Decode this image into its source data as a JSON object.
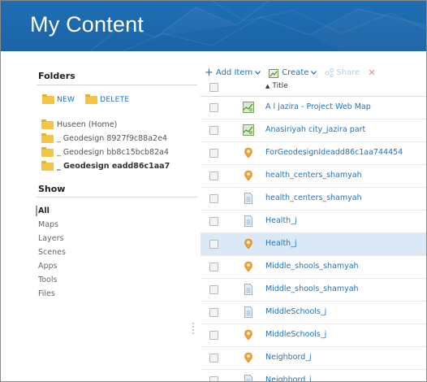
{
  "header": {
    "title": "My Content"
  },
  "sidebar": {
    "folders_heading": "Folders",
    "new_label": "NEW",
    "delete_label": "DELETE",
    "folders": [
      {
        "label": "Huseen (Home)"
      },
      {
        "label": "_ Geodesign 8927f9c88a2e4"
      },
      {
        "label": "_ Geodesign bb8c15bcb82a4"
      },
      {
        "label": "_ Geodesign eadd86c1aa7"
      }
    ],
    "show_heading": "Show",
    "show_items": [
      {
        "label": "All"
      },
      {
        "label": "Maps"
      },
      {
        "label": "Layers"
      },
      {
        "label": "Scenes"
      },
      {
        "label": "Apps"
      },
      {
        "label": "Tools"
      },
      {
        "label": "Files"
      }
    ]
  },
  "toolbar": {
    "add_item": "Add Item",
    "create": "Create",
    "share": "Share"
  },
  "table": {
    "title_header": "Title",
    "rows": [
      {
        "title": "A l jazira - Project Web Map",
        "icon": "web-map-icon"
      },
      {
        "title": "Anasiriyah city_jazira part",
        "icon": "web-map-icon"
      },
      {
        "title": "ForGeodesignIdeadd86c1aa744454",
        "icon": "feature-layer-icon"
      },
      {
        "title": "health_centers_shamyah",
        "icon": "feature-layer-icon"
      },
      {
        "title": "health_centers_shamyah",
        "icon": "file-icon"
      },
      {
        "title": "Health_j",
        "icon": "file-icon"
      },
      {
        "title": "Health_j",
        "icon": "feature-layer-icon"
      },
      {
        "title": "Middle_shools_shamyah",
        "icon": "feature-layer-icon"
      },
      {
        "title": "Middle_shools_shamyah",
        "icon": "file-icon"
      },
      {
        "title": "MiddleSchools_j",
        "icon": "file-icon"
      },
      {
        "title": "MiddleSchools_j",
        "icon": "feature-layer-icon"
      },
      {
        "title": "Neighbord_j",
        "icon": "feature-layer-icon"
      },
      {
        "title": "Neighbord_j",
        "icon": "file-icon"
      }
    ]
  },
  "colors": {
    "header_blue": "#1f6fb5",
    "link_blue": "#1a73c7",
    "folder_yellow": "#f2c544",
    "row_highlight": "#dbe9f6"
  }
}
